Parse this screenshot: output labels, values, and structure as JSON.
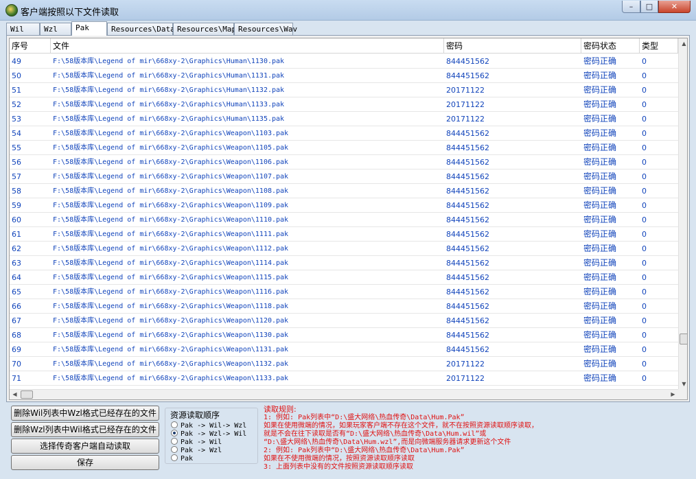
{
  "window": {
    "title": "客户端按照以下文件读取"
  },
  "tabs": [
    {
      "label": "Wil"
    },
    {
      "label": "Wzl"
    },
    {
      "label": "Pak"
    },
    {
      "label": "Resources\\Data"
    },
    {
      "label": "Resources\\Map"
    },
    {
      "label": "Resources\\Wav"
    }
  ],
  "table": {
    "headers": [
      "序号",
      "文件",
      "密码",
      "密码状态",
      "类型"
    ],
    "rows": [
      [
        "49",
        "F:\\58版本库\\Legend of mir\\668xy-2\\Graphics\\Human\\1130.pak",
        "844451562",
        "密码正确",
        "0"
      ],
      [
        "50",
        "F:\\58版本库\\Legend of mir\\668xy-2\\Graphics\\Human\\1131.pak",
        "844451562",
        "密码正确",
        "0"
      ],
      [
        "51",
        "F:\\58版本库\\Legend of mir\\668xy-2\\Graphics\\Human\\1132.pak",
        "20171122",
        "密码正确",
        "0"
      ],
      [
        "52",
        "F:\\58版本库\\Legend of mir\\668xy-2\\Graphics\\Human\\1133.pak",
        "20171122",
        "密码正确",
        "0"
      ],
      [
        "53",
        "F:\\58版本库\\Legend of mir\\668xy-2\\Graphics\\Human\\1135.pak",
        "20171122",
        "密码正确",
        "0"
      ],
      [
        "54",
        "F:\\58版本库\\Legend of mir\\668xy-2\\Graphics\\Weapon\\1103.pak",
        "844451562",
        "密码正确",
        "0"
      ],
      [
        "55",
        "F:\\58版本库\\Legend of mir\\668xy-2\\Graphics\\Weapon\\1105.pak",
        "844451562",
        "密码正确",
        "0"
      ],
      [
        "56",
        "F:\\58版本库\\Legend of mir\\668xy-2\\Graphics\\Weapon\\1106.pak",
        "844451562",
        "密码正确",
        "0"
      ],
      [
        "57",
        "F:\\58版本库\\Legend of mir\\668xy-2\\Graphics\\Weapon\\1107.pak",
        "844451562",
        "密码正确",
        "0"
      ],
      [
        "58",
        "F:\\58版本库\\Legend of mir\\668xy-2\\Graphics\\Weapon\\1108.pak",
        "844451562",
        "密码正确",
        "0"
      ],
      [
        "59",
        "F:\\58版本库\\Legend of mir\\668xy-2\\Graphics\\Weapon\\1109.pak",
        "844451562",
        "密码正确",
        "0"
      ],
      [
        "60",
        "F:\\58版本库\\Legend of mir\\668xy-2\\Graphics\\Weapon\\1110.pak",
        "844451562",
        "密码正确",
        "0"
      ],
      [
        "61",
        "F:\\58版本库\\Legend of mir\\668xy-2\\Graphics\\Weapon\\1111.pak",
        "844451562",
        "密码正确",
        "0"
      ],
      [
        "62",
        "F:\\58版本库\\Legend of mir\\668xy-2\\Graphics\\Weapon\\1112.pak",
        "844451562",
        "密码正确",
        "0"
      ],
      [
        "63",
        "F:\\58版本库\\Legend of mir\\668xy-2\\Graphics\\Weapon\\1114.pak",
        "844451562",
        "密码正确",
        "0"
      ],
      [
        "64",
        "F:\\58版本库\\Legend of mir\\668xy-2\\Graphics\\Weapon\\1115.pak",
        "844451562",
        "密码正确",
        "0"
      ],
      [
        "65",
        "F:\\58版本库\\Legend of mir\\668xy-2\\Graphics\\Weapon\\1116.pak",
        "844451562",
        "密码正确",
        "0"
      ],
      [
        "66",
        "F:\\58版本库\\Legend of mir\\668xy-2\\Graphics\\Weapon\\1118.pak",
        "844451562",
        "密码正确",
        "0"
      ],
      [
        "67",
        "F:\\58版本库\\Legend of mir\\668xy-2\\Graphics\\Weapon\\1120.pak",
        "844451562",
        "密码正确",
        "0"
      ],
      [
        "68",
        "F:\\58版本库\\Legend of mir\\668xy-2\\Graphics\\Weapon\\1130.pak",
        "844451562",
        "密码正确",
        "0"
      ],
      [
        "69",
        "F:\\58版本库\\Legend of mir\\668xy-2\\Graphics\\Weapon\\1131.pak",
        "844451562",
        "密码正确",
        "0"
      ],
      [
        "70",
        "F:\\58版本库\\Legend of mir\\668xy-2\\Graphics\\Weapon\\1132.pak",
        "20171122",
        "密码正确",
        "0"
      ],
      [
        "71",
        "F:\\58版本库\\Legend of mir\\668xy-2\\Graphics\\Weapon\\1133.pak",
        "20171122",
        "密码正确",
        "0"
      ]
    ]
  },
  "buttons": {
    "delete_wil": "删除Wil列表中Wzl格式已经存在的文件",
    "delete_wzl": "删除Wzl列表中Wil格式已经存在的文件",
    "select_client": "选择传奇客户端自动读取",
    "save": "保存"
  },
  "read_order": {
    "title": "资源读取顺序",
    "options": [
      "Pak -> Wil-> Wzl",
      "Pak -> Wzl-> Wil",
      "Pak -> Wil",
      "Pak -> Wzl",
      "Pak"
    ],
    "selected_index": 1
  },
  "rules": {
    "title": "读取规则:",
    "lines": [
      "1: 例如: Pak列表中“D:\\盛大网络\\热血传奇\\Data\\Hum.Pak”",
      "    如果在使用微端的情况，如果玩家客户端不存在这个文件，就不在按照资源读取顺序读取，",
      "    就是不会在往下读取是否有“D:\\盛大网络\\热血传奇\\Data\\Hum.wil”或",
      "    “D:\\盛大网络\\热血传奇\\Data\\Hum.wzl”,而是向微端服务器请求更新这个文件",
      "2: 例如: Pak列表中“D:\\盛大网络\\热血传奇\\Data\\Hum.Pak”",
      "    如果在不使用微端的情况，按照资源读取顺序读取",
      "3: 上面列表中没有的文件按照资源读取顺序读取"
    ]
  },
  "icons": {
    "app": "game-app-icon",
    "minimize": "minimize-icon",
    "maximize": "maximize-icon",
    "close": "close-icon"
  }
}
